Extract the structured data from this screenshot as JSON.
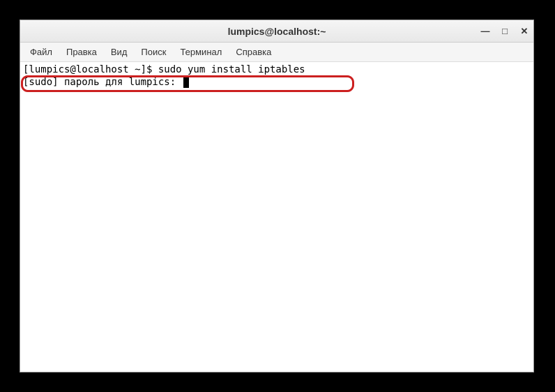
{
  "titlebar": {
    "title": "lumpics@localhost:~"
  },
  "window_controls": {
    "minimize": "—",
    "maximize": "□",
    "close": "✕"
  },
  "menubar": {
    "items": [
      {
        "label": "Файл"
      },
      {
        "label": "Правка"
      },
      {
        "label": "Вид"
      },
      {
        "label": "Поиск"
      },
      {
        "label": "Терминал"
      },
      {
        "label": "Справка"
      }
    ]
  },
  "terminal": {
    "line1": "[lumpics@localhost ~]$ sudo yum install iptables",
    "line2": "[sudo] пароль для lumpics: "
  }
}
